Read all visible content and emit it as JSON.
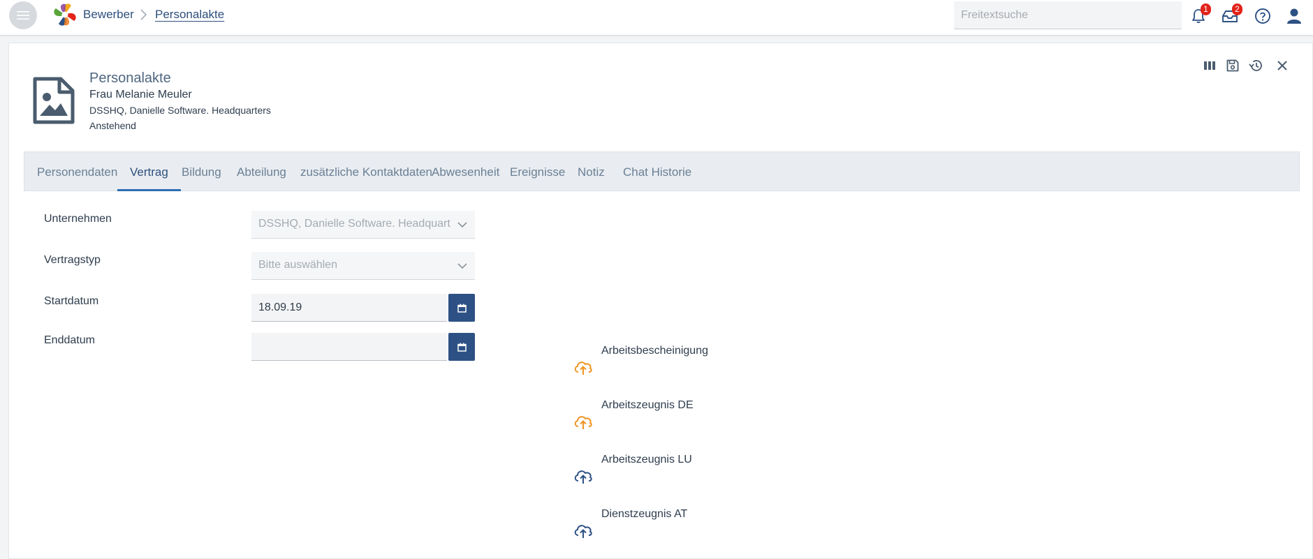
{
  "colors": {
    "brand": "#2d5184",
    "accent": "#2d6db3",
    "upload_pending": "#f09422",
    "upload_default": "#2d5184",
    "badge": "#e2231a"
  },
  "topbar": {
    "breadcrumb": [
      "Bewerber",
      "Personalakte"
    ],
    "search_placeholder": "Freitextsuche",
    "notifications_count": "1",
    "messages_count": "2",
    "icons": [
      "menu-icon",
      "bell-icon",
      "inbox-icon",
      "help-icon",
      "user-icon"
    ]
  },
  "header": {
    "title": "Personalakte",
    "name": "Frau Melanie Meuler",
    "company": "DSSHQ, Danielle Software. Headquarters",
    "status": "Anstehend",
    "actions": [
      "columns-icon",
      "save-icon",
      "history-icon",
      "close-icon"
    ]
  },
  "tabs": [
    {
      "label": "Personendaten"
    },
    {
      "label": "Vertrag"
    },
    {
      "label": "Bildung"
    },
    {
      "label": "Abteilung"
    },
    {
      "label": "zusätzliche Kontaktdaten"
    },
    {
      "label": "Abwesenheit"
    },
    {
      "label": "Ereignisse"
    },
    {
      "label": "Notiz"
    },
    {
      "label": "Chat Historie"
    }
  ],
  "active_tab": "Vertrag",
  "form": {
    "company_label": "Unternehmen",
    "company_value": "DSSHQ, Danielle Software. Headquarters",
    "contract_type_label": "Vertragstyp",
    "contract_type_value": "Bitte auswählen",
    "start_label": "Startdatum",
    "start_value": "18.09.19",
    "end_label": "Enddatum",
    "end_value": ""
  },
  "uploads": [
    {
      "label": "Arbeitsbescheinigung",
      "state": "pending"
    },
    {
      "label": "Arbeitszeugnis DE",
      "state": "pending"
    },
    {
      "label": "Arbeitszeugnis LU",
      "state": "default"
    },
    {
      "label": "Dienstzeugnis AT",
      "state": "default"
    }
  ]
}
